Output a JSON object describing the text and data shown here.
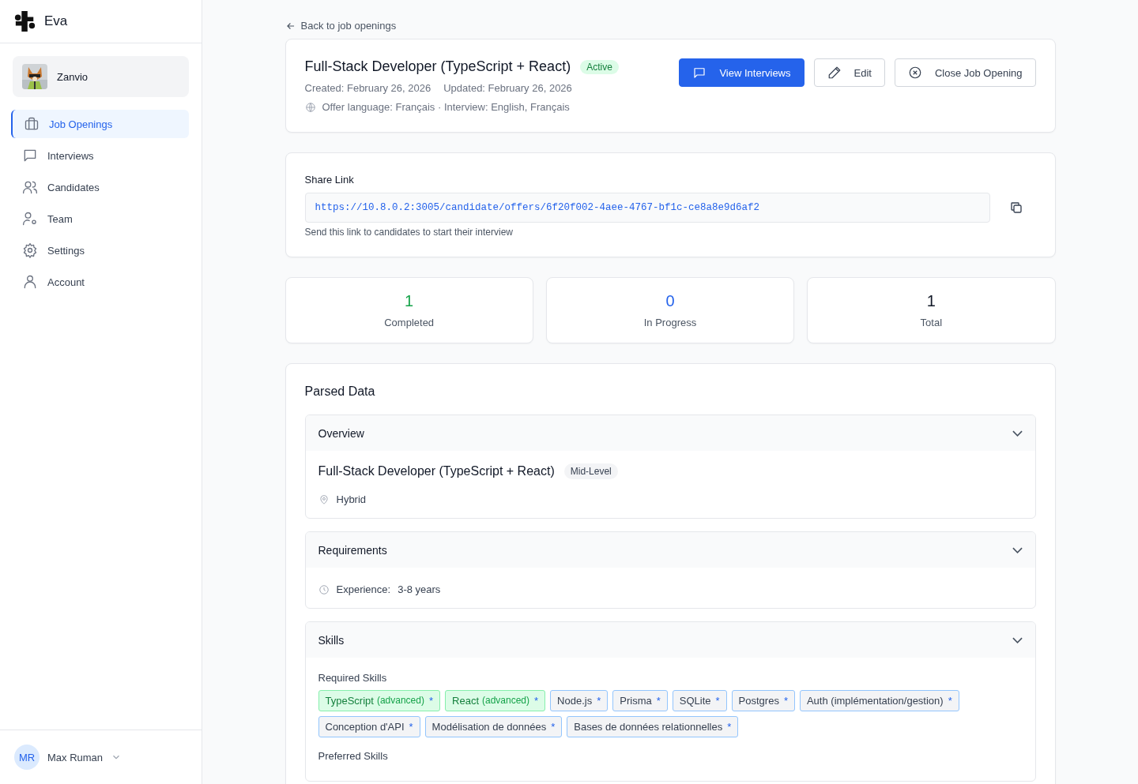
{
  "brand": {
    "name": "Eva"
  },
  "workspace": {
    "name": "Zanvio"
  },
  "nav": [
    {
      "label": "Job Openings",
      "selected": true
    },
    {
      "label": "Interviews",
      "selected": false
    },
    {
      "label": "Candidates",
      "selected": false
    },
    {
      "label": "Team",
      "selected": false
    },
    {
      "label": "Settings",
      "selected": false
    },
    {
      "label": "Account",
      "selected": false
    }
  ],
  "user": {
    "initials": "MR",
    "name": "Max Ruman"
  },
  "back_link": "Back to job openings",
  "job": {
    "title": "Full-Stack Developer (TypeScript + React)",
    "status": "Active",
    "created": "Created: February 26, 2026",
    "updated": "Updated: February 26, 2026",
    "languages": "Offer language: Français · Interview: English, Français"
  },
  "actions": [
    {
      "label": "View Interviews",
      "kind": "primary"
    },
    {
      "label": "Edit",
      "kind": "outline"
    },
    {
      "label": "Close Job Opening",
      "kind": "outline"
    }
  ],
  "share": {
    "label": "Share Link",
    "url": "https://10.8.0.2:3005/candidate/offers/6f20f002-4aee-4767-bf1c-ce8a8e9d6af2",
    "hint": "Send this link to candidates to start their interview"
  },
  "stats": [
    {
      "value": "1",
      "label": "Completed",
      "color": "#16a34a"
    },
    {
      "value": "0",
      "label": "In Progress",
      "color": "#2563eb"
    },
    {
      "value": "1",
      "label": "Total",
      "color": "#111827"
    }
  ],
  "parsed": {
    "title": "Parsed Data",
    "sections": [
      {
        "kind": "overview",
        "title": "Overview",
        "expanded": true,
        "heading": "Full-Stack Developer (TypeScript + React)",
        "badge": "Mid-Level",
        "location": "Hybrid"
      },
      {
        "kind": "requirements",
        "title": "Requirements",
        "expanded": true,
        "label": "Experience:",
        "value": "3-8 years"
      },
      {
        "kind": "skills",
        "title": "Skills",
        "expanded": true,
        "groups": [
          {
            "label": "Required Skills",
            "skills": [
              {
                "name": "TypeScript",
                "proficiency": "(advanced)",
                "marker": "*",
                "highlighted": true
              },
              {
                "name": "React",
                "proficiency": "(advanced)",
                "marker": "*",
                "highlighted": true
              },
              {
                "name": "Node.js",
                "marker": "*",
                "highlighted": false
              },
              {
                "name": "Prisma",
                "marker": "*",
                "highlighted": false
              },
              {
                "name": "SQLite",
                "marker": "*",
                "highlighted": false
              },
              {
                "name": "Postgres",
                "marker": "*",
                "highlighted": false
              },
              {
                "name": "Auth (implémentation/gestion)",
                "marker": "*",
                "highlighted": false
              },
              {
                "name": "Conception d'API",
                "marker": "*",
                "highlighted": false
              },
              {
                "name": "Modélisation de données",
                "marker": "*",
                "highlighted": false
              },
              {
                "name": "Bases de données relationnelles",
                "marker": "*",
                "highlighted": false
              }
            ]
          },
          {
            "label": "Preferred Skills"
          }
        ]
      }
    ]
  }
}
